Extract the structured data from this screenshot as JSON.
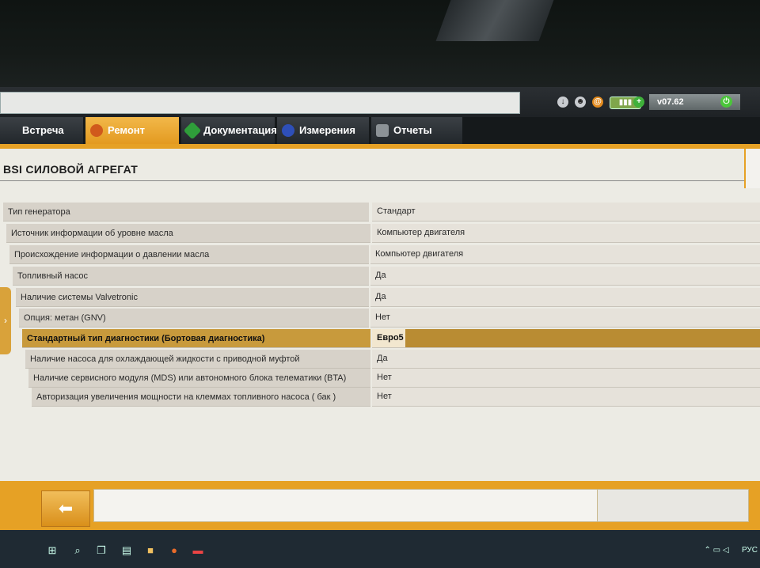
{
  "app": {
    "version": "v07.62"
  },
  "tabs": [
    {
      "label": "Встреча",
      "active": false,
      "icon": "welcome-icon"
    },
    {
      "label": "Ремонт",
      "active": true,
      "icon": "magnifier-icon"
    },
    {
      "label": "Документация",
      "active": false,
      "icon": "book-icon"
    },
    {
      "label": "Измерения",
      "active": false,
      "icon": "waveform-icon"
    },
    {
      "label": "Отчеты",
      "active": false,
      "icon": "report-icon"
    }
  ],
  "panel": {
    "title": "BSI  СИЛОВОЙ АГРЕГАТ"
  },
  "rows": [
    {
      "label": "Тип генератора",
      "value": "Стандарт"
    },
    {
      "label": "Источник информации об уровне масла",
      "value": "Компьютер двигателя"
    },
    {
      "label": "Происхождение информации о давлении масла",
      "value": "Компьютер двигателя"
    },
    {
      "label": "Топливный насос",
      "value": "Да"
    },
    {
      "label": "Наличие системы Valvetronic",
      "value": "Да"
    },
    {
      "label": "Опция: метан (GNV)",
      "value": "Нет"
    },
    {
      "label": "Стандартный тип диагностики (Бортовая диагностика)",
      "value": "Евро5",
      "selected": true
    },
    {
      "label": "Наличие насоса для охлаждающей жидкости с приводной муфтой",
      "value": "Да"
    },
    {
      "label": "Наличие сервисного модуля (MDS) или автономного блока телематики (BTA)",
      "value": "Нет"
    },
    {
      "label": "Авторизация увеличения мощности на клеммах топливного насоса ( бак )",
      "value": "Нет"
    }
  ],
  "tray": {
    "lang": "РУС"
  },
  "colors": {
    "accent": "#e6a125",
    "selected_row": "#c89a3c"
  }
}
